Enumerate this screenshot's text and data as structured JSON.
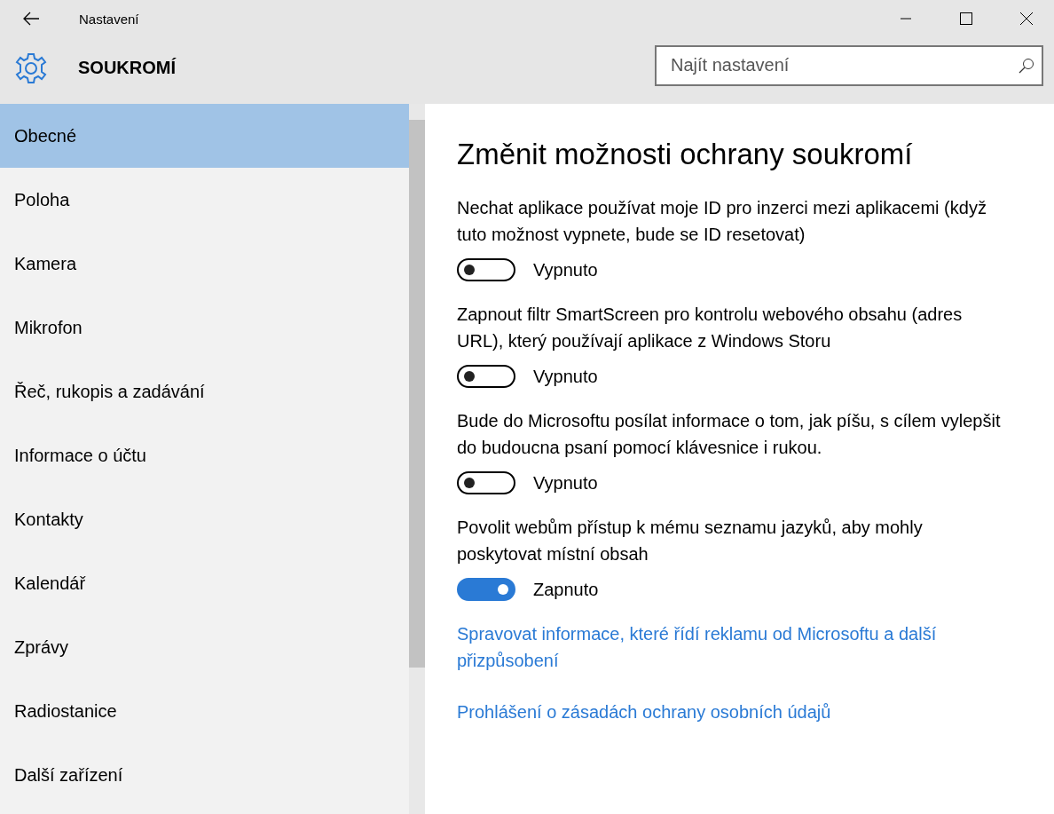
{
  "window": {
    "title": "Nastavení"
  },
  "header": {
    "title": "SOUKROMÍ"
  },
  "search": {
    "placeholder": "Najít nastavení"
  },
  "sidebar": {
    "items": [
      {
        "label": "Obecné",
        "selected": true
      },
      {
        "label": "Poloha",
        "selected": false
      },
      {
        "label": "Kamera",
        "selected": false
      },
      {
        "label": "Mikrofon",
        "selected": false
      },
      {
        "label": "Řeč, rukopis a zadávání",
        "selected": false
      },
      {
        "label": "Informace o účtu",
        "selected": false
      },
      {
        "label": "Kontakty",
        "selected": false
      },
      {
        "label": "Kalendář",
        "selected": false
      },
      {
        "label": "Zprávy",
        "selected": false
      },
      {
        "label": "Radiostanice",
        "selected": false
      },
      {
        "label": "Další zařízení",
        "selected": false
      }
    ]
  },
  "content": {
    "heading": "Změnit možnosti ochrany soukromí",
    "settings": [
      {
        "description": "Nechat aplikace používat moje ID pro inzerci mezi aplikacemi (když tuto možnost vypnete, bude se ID resetovat)",
        "on": false,
        "state_label": "Vypnuto"
      },
      {
        "description": "Zapnout filtr SmartScreen pro kontrolu webového obsahu (adres URL), který používají aplikace z Windows Storu",
        "on": false,
        "state_label": "Vypnuto"
      },
      {
        "description": "Bude do Microsoftu posílat informace o tom, jak píšu, s cílem vylepšit do budoucna psaní pomocí klávesnice i rukou.",
        "on": false,
        "state_label": "Vypnuto"
      },
      {
        "description": "Povolit webům přístup k mému seznamu jazyků, aby mohly poskytovat místní obsah",
        "on": true,
        "state_label": "Zapnuto"
      }
    ],
    "links": [
      "Spravovat informace, které řídí reklamu od Microsoftu a další přizpůsobení",
      "Prohlášení o zásadách ochrany osobních údajů"
    ]
  }
}
